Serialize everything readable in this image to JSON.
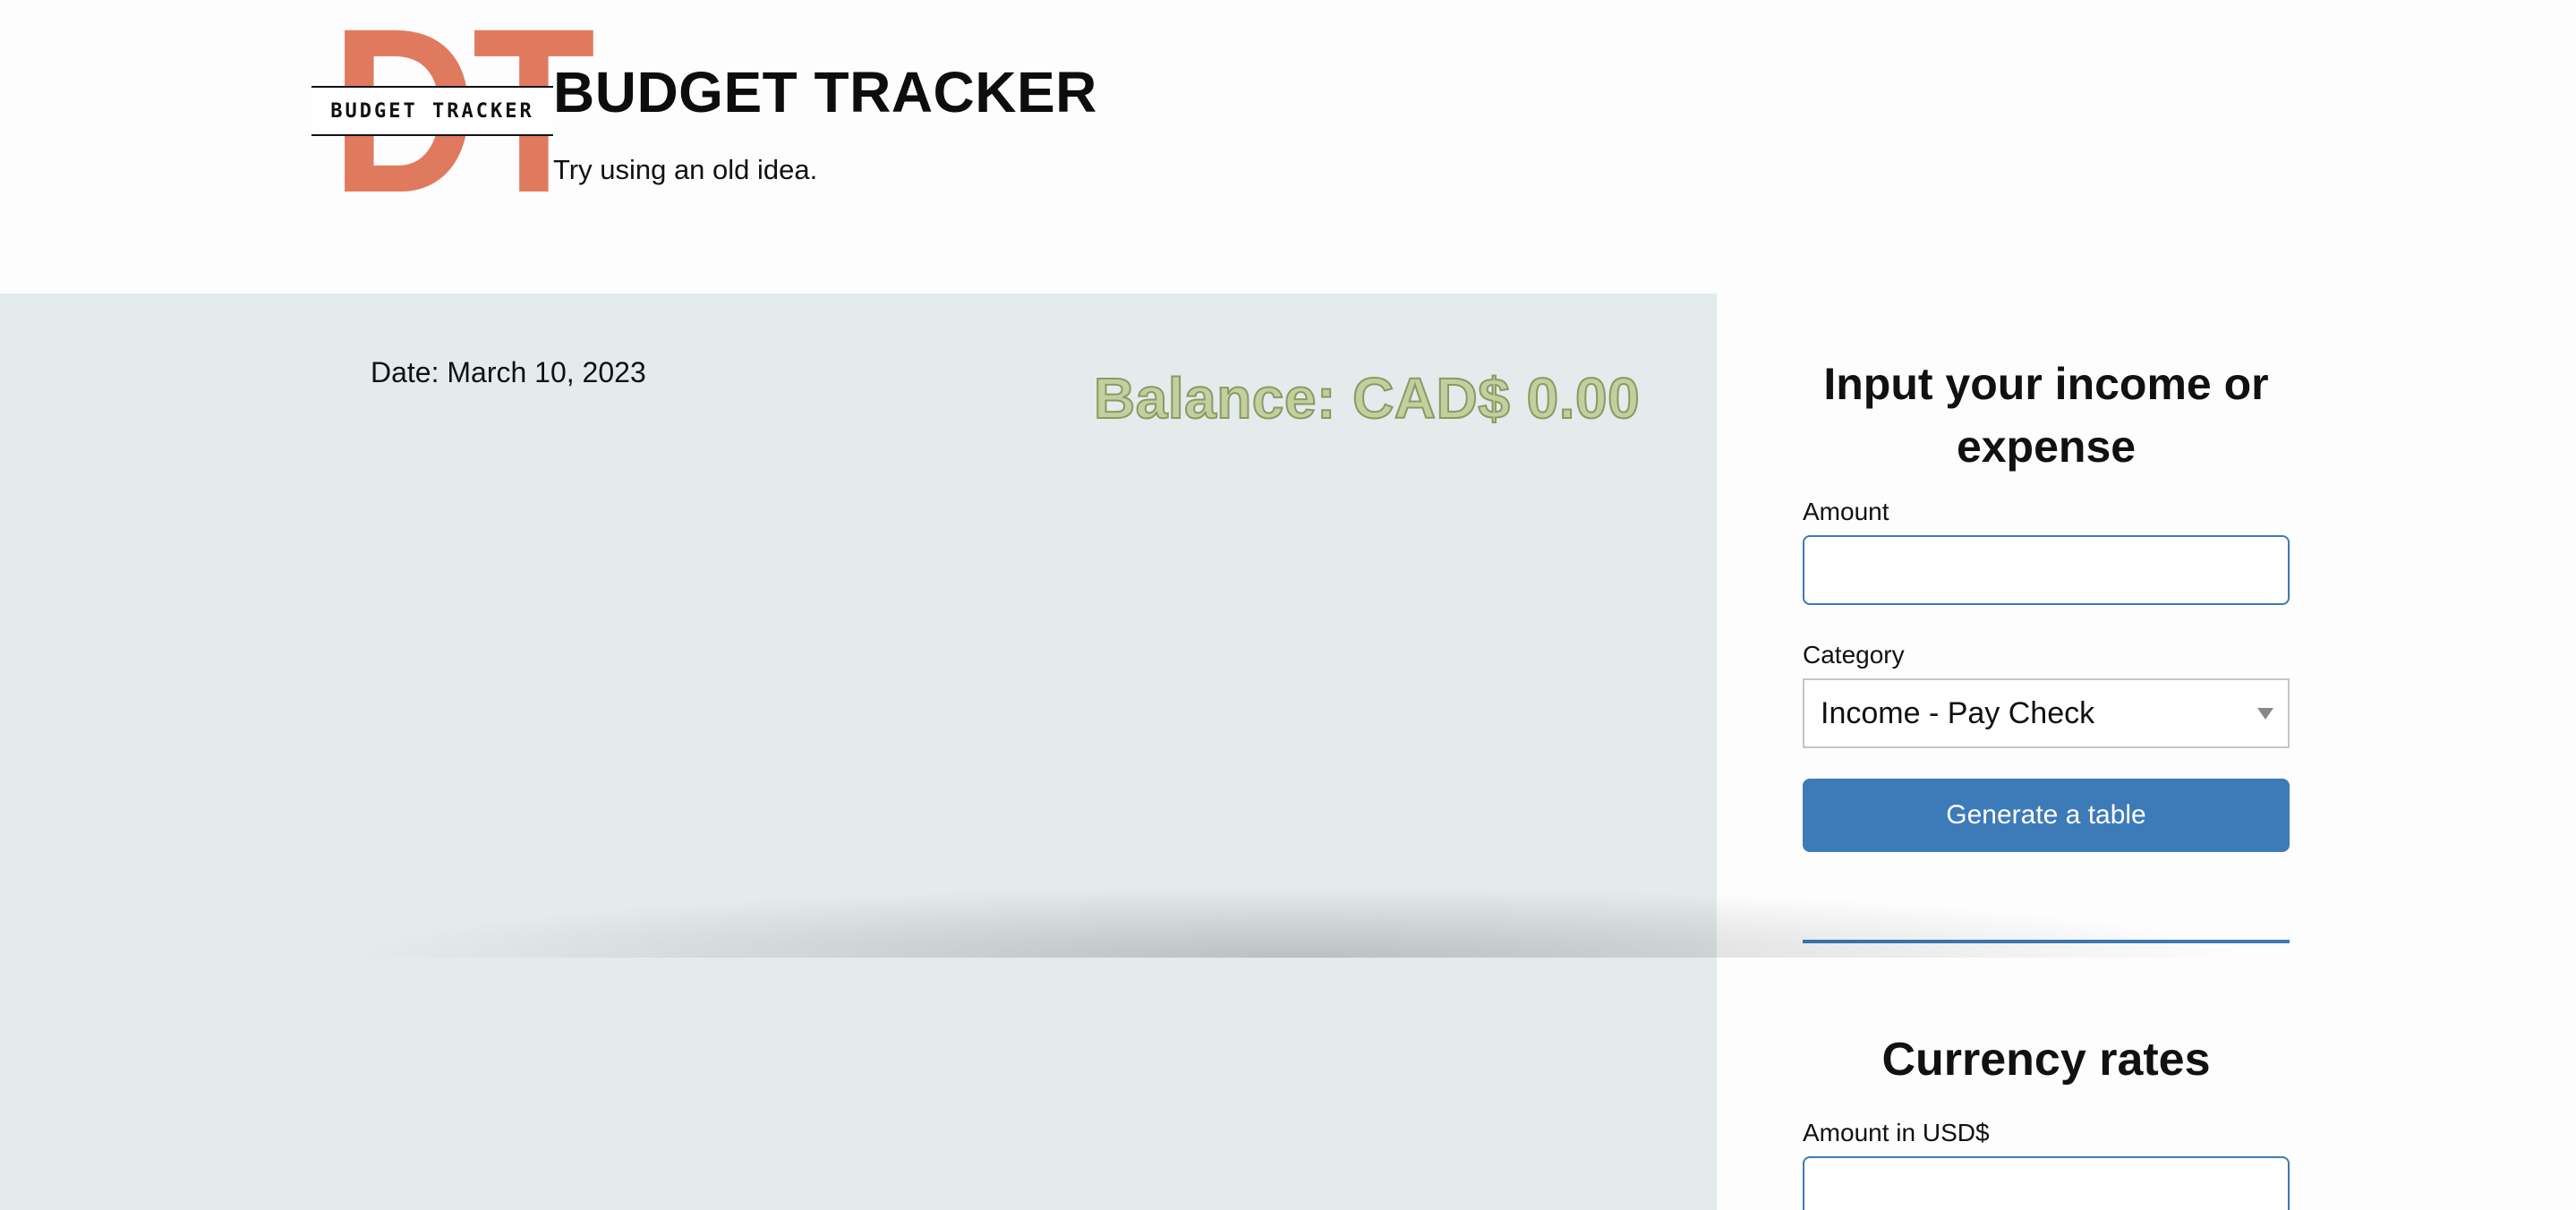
{
  "header": {
    "logo_letters": "DT",
    "logo_band_text": "BUDGET TRACKER",
    "title": "BUDGET TRACKER",
    "tagline": "Try using an old idea."
  },
  "summary": {
    "date_text": "Date: March 10, 2023",
    "balance_text": "Balance: CAD$ 0.00"
  },
  "form": {
    "title": "Input your income or expense",
    "amount_label": "Amount",
    "amount_value": "",
    "category_label": "Category",
    "category_selected": "Income - Pay Check",
    "generate_button_label": "Generate a table"
  },
  "currency": {
    "title": "Currency rates",
    "usd_label": "Amount in USD$",
    "usd_value": ""
  },
  "colors": {
    "accent": "#3d7ab8",
    "logo": "#e07a5f",
    "balance_fill": "#c3cf9e",
    "left_panel_bg": "#e4ebed"
  }
}
